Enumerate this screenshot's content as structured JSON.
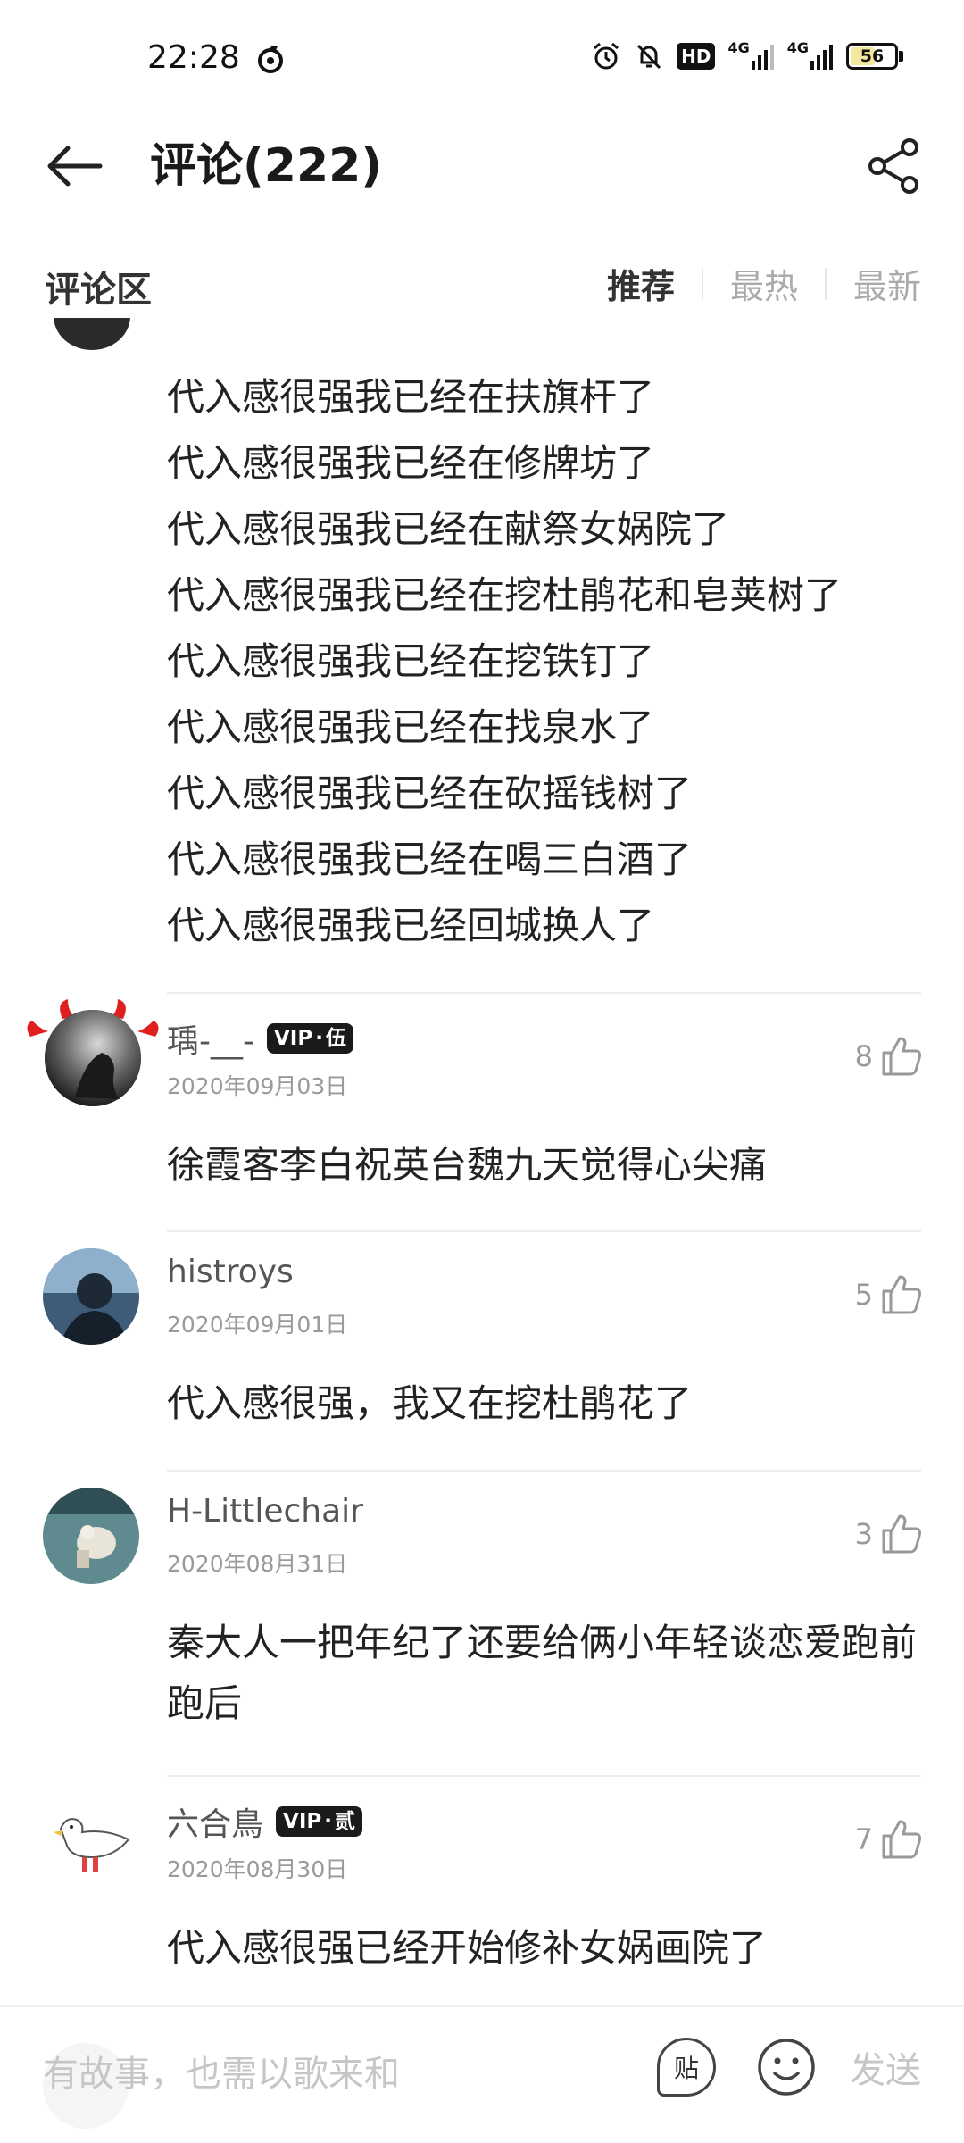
{
  "status": {
    "time": "22:28",
    "hd": "HD",
    "net1": "4G",
    "net2": "4G",
    "battery": "56",
    "battery_level": 0.56
  },
  "header": {
    "title": "评论(222)"
  },
  "section": {
    "title": "评论区",
    "tabs": [
      "推荐",
      "最热",
      "最新"
    ],
    "active_tab": "推荐"
  },
  "top_comment_lines": [
    "代入感很强我已经在扶旗杆了",
    "代入感很强我已经在修牌坊了",
    "代入感很强我已经在献祭女娲院了",
    "代入感很强我已经在挖杜鹃花和皂荚树了",
    "代入感很强我已经在挖铁钉了",
    "代入感很强我已经在找泉水了",
    "代入感很强我已经在砍摇钱树了",
    "代入感很强我已经在喝三白酒了",
    "代入感很强我已经回城换人了"
  ],
  "comments": [
    {
      "name": "瑀-__-",
      "vip": "伍",
      "date": "2020年09月03日",
      "likes": "8",
      "text": "徐霞客李白祝英台魏九天觉得心尖痛"
    },
    {
      "name": "histroys",
      "vip": "",
      "date": "2020年09月01日",
      "likes": "5",
      "text": "代入感很强，我又在挖杜鹃花了"
    },
    {
      "name": "H-Littlechair",
      "vip": "",
      "date": "2020年08月31日",
      "likes": "3",
      "text": "秦大人一把年纪了还要给俩小年轻谈恋爱跑前跑后"
    },
    {
      "name": "六合鳥",
      "vip": "贰",
      "date": "2020年08月30日",
      "likes": "7",
      "text": "代入感很强已经开始修补女娲画院了"
    }
  ],
  "vip_label": "VIP",
  "input": {
    "placeholder": "有故事，也需以歌来和",
    "tie_label": "贴",
    "send_label": "发送"
  }
}
